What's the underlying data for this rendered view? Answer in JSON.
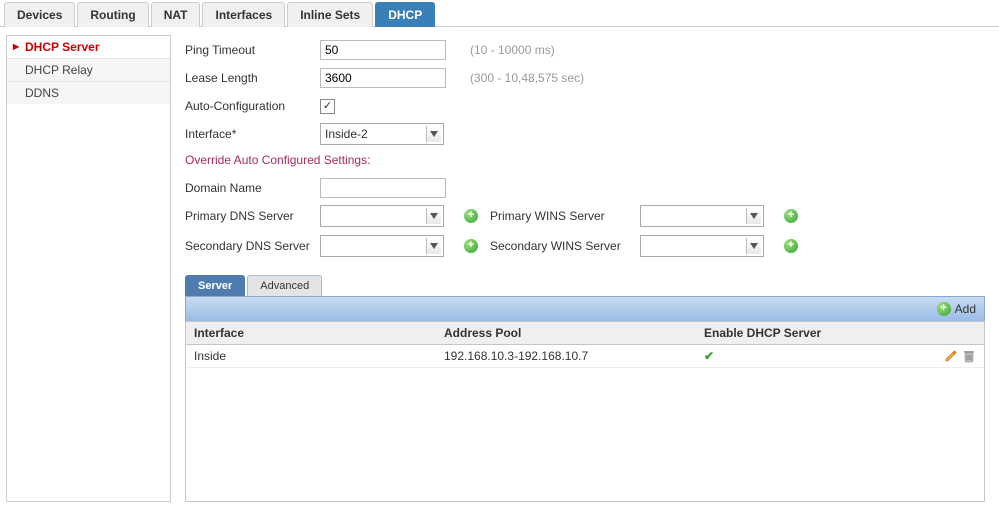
{
  "tabs": {
    "items": [
      {
        "label": "Devices",
        "active": false
      },
      {
        "label": "Routing",
        "active": false
      },
      {
        "label": "NAT",
        "active": false
      },
      {
        "label": "Interfaces",
        "active": false
      },
      {
        "label": "Inline Sets",
        "active": false
      },
      {
        "label": "DHCP",
        "active": true
      }
    ]
  },
  "sidebar": {
    "items": [
      {
        "label": "DHCP Server",
        "active": true
      },
      {
        "label": "DHCP Relay",
        "active": false
      },
      {
        "label": "DDNS",
        "active": false
      }
    ]
  },
  "form": {
    "ping_timeout": {
      "label": "Ping Timeout",
      "value": "50",
      "hint": "(10 - 10000 ms)"
    },
    "lease_length": {
      "label": "Lease Length",
      "value": "3600",
      "hint": "(300 - 10,48,575 sec)"
    },
    "auto_config": {
      "label": "Auto-Configuration",
      "checked": true
    },
    "interface": {
      "label": "Interface*",
      "value": "Inside-2"
    },
    "override_title": "Override Auto Configured Settings:",
    "domain_name": {
      "label": "Domain Name",
      "value": ""
    },
    "primary_dns": {
      "label": "Primary DNS Server",
      "value": ""
    },
    "secondary_dns": {
      "label": "Secondary DNS Server",
      "value": ""
    },
    "primary_wins": {
      "label": "Primary WINS Server",
      "value": ""
    },
    "secondary_wins": {
      "label": "Secondary WINS Server",
      "value": ""
    }
  },
  "sub_tabs": {
    "items": [
      {
        "label": "Server",
        "active": true
      },
      {
        "label": "Advanced",
        "active": false
      }
    ]
  },
  "toolbar": {
    "add_label": "Add"
  },
  "grid": {
    "columns": {
      "c0": "Interface",
      "c1": "Address Pool",
      "c2": "Enable DHCP Server"
    },
    "rows": [
      {
        "interface": "Inside",
        "pool": "192.168.10.3-192.168.10.7",
        "enabled": true
      }
    ]
  }
}
